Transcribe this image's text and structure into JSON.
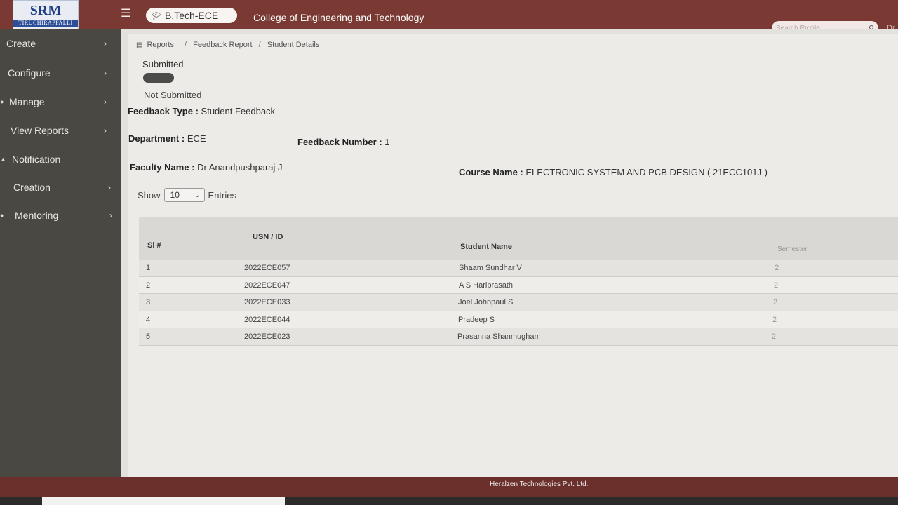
{
  "header": {
    "logo_text": "SRM",
    "logo_sub": "TIRUCHIRAPPALLI",
    "program": "B.Tech-ECE",
    "college_title": "College of Engineering and Technology",
    "search_placeholder": "Search Profile",
    "user_short": "Dr"
  },
  "sidebar": {
    "items": [
      {
        "label": "Create"
      },
      {
        "label": "Configure"
      },
      {
        "label": "Manage"
      },
      {
        "label": "View Reports"
      },
      {
        "label": "Notification"
      },
      {
        "label": "Creation"
      },
      {
        "label": "Mentoring"
      }
    ]
  },
  "breadcrumb": {
    "items": [
      "Reports",
      "Feedback Report",
      "Student Details"
    ]
  },
  "legend": {
    "submitted": "Submitted",
    "not_submitted": "Not Submitted"
  },
  "details": {
    "feedback_type_label": "Feedback Type :",
    "feedback_type_value": "Student Feedback",
    "department_label": "Department :",
    "department_value": "ECE",
    "feedback_number_label": "Feedback Number :",
    "feedback_number_value": "1",
    "faculty_label": "Faculty Name :",
    "faculty_value": "Dr Anandpushparaj J",
    "course_label": "Course Name :",
    "course_value": "ELECTRONIC SYSTEM AND PCB DESIGN ( 21ECC101J )"
  },
  "entries": {
    "show_label": "Show",
    "value": "10",
    "entries_label": "Entries"
  },
  "table": {
    "headers": {
      "sl": "Sl #",
      "usn": "USN / ID",
      "name": "Student Name",
      "semester": "Semester"
    },
    "rows": [
      {
        "sl": "1",
        "usn": "2022ECE057",
        "name": "Shaam Sundhar V",
        "semester": "2"
      },
      {
        "sl": "2",
        "usn": "2022ECE047",
        "name": "A S Hariprasath",
        "semester": "2"
      },
      {
        "sl": "3",
        "usn": "2022ECE033",
        "name": "Joel Johnpaul S",
        "semester": "2"
      },
      {
        "sl": "4",
        "usn": "2022ECE044",
        "name": "Pradeep S",
        "semester": "2"
      },
      {
        "sl": "5",
        "usn": "2022ECE023",
        "name": "Prasanna Shanmugham",
        "semester": "2"
      }
    ]
  },
  "footer": {
    "text": "Heralzen Technologies Pvt. Ltd."
  },
  "colors": {
    "header": "#7a3a33",
    "sidebar": "#4a4843",
    "footer": "#6b302b",
    "legend_submitted": "#4b4b4a"
  }
}
